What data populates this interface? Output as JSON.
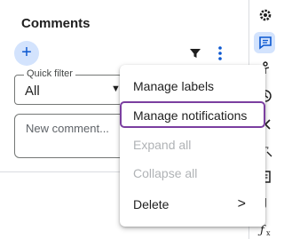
{
  "comments_panel": {
    "title": "Comments",
    "add_button_label": "+",
    "filter_icon": "filter-icon",
    "more_icon": "more-vert-icon",
    "quick_filter": {
      "legend": "Quick filter",
      "value": "All"
    },
    "new_comment_placeholder": "New comment..."
  },
  "context_menu": {
    "items": [
      {
        "label": "Manage labels",
        "enabled": true
      },
      {
        "label": "Manage notifications",
        "enabled": true,
        "focused": true
      },
      {
        "label": "Expand all",
        "enabled": false
      },
      {
        "label": "Collapse all",
        "enabled": false
      },
      {
        "label": "Delete",
        "enabled": true,
        "has_submenu": true
      }
    ],
    "submenu_arrow": ">"
  },
  "side_rail": {
    "icons": [
      "settings-icon",
      "comments-icon",
      "accessibility-icon",
      "history-icon",
      "close-icon",
      "clear-format-icon",
      "document-icon",
      "link-icon",
      "function-icon"
    ]
  },
  "colors": {
    "accent": "#0b57d0",
    "accent_bg": "#d3e3fd",
    "focus_ring": "#7b3fa0"
  }
}
